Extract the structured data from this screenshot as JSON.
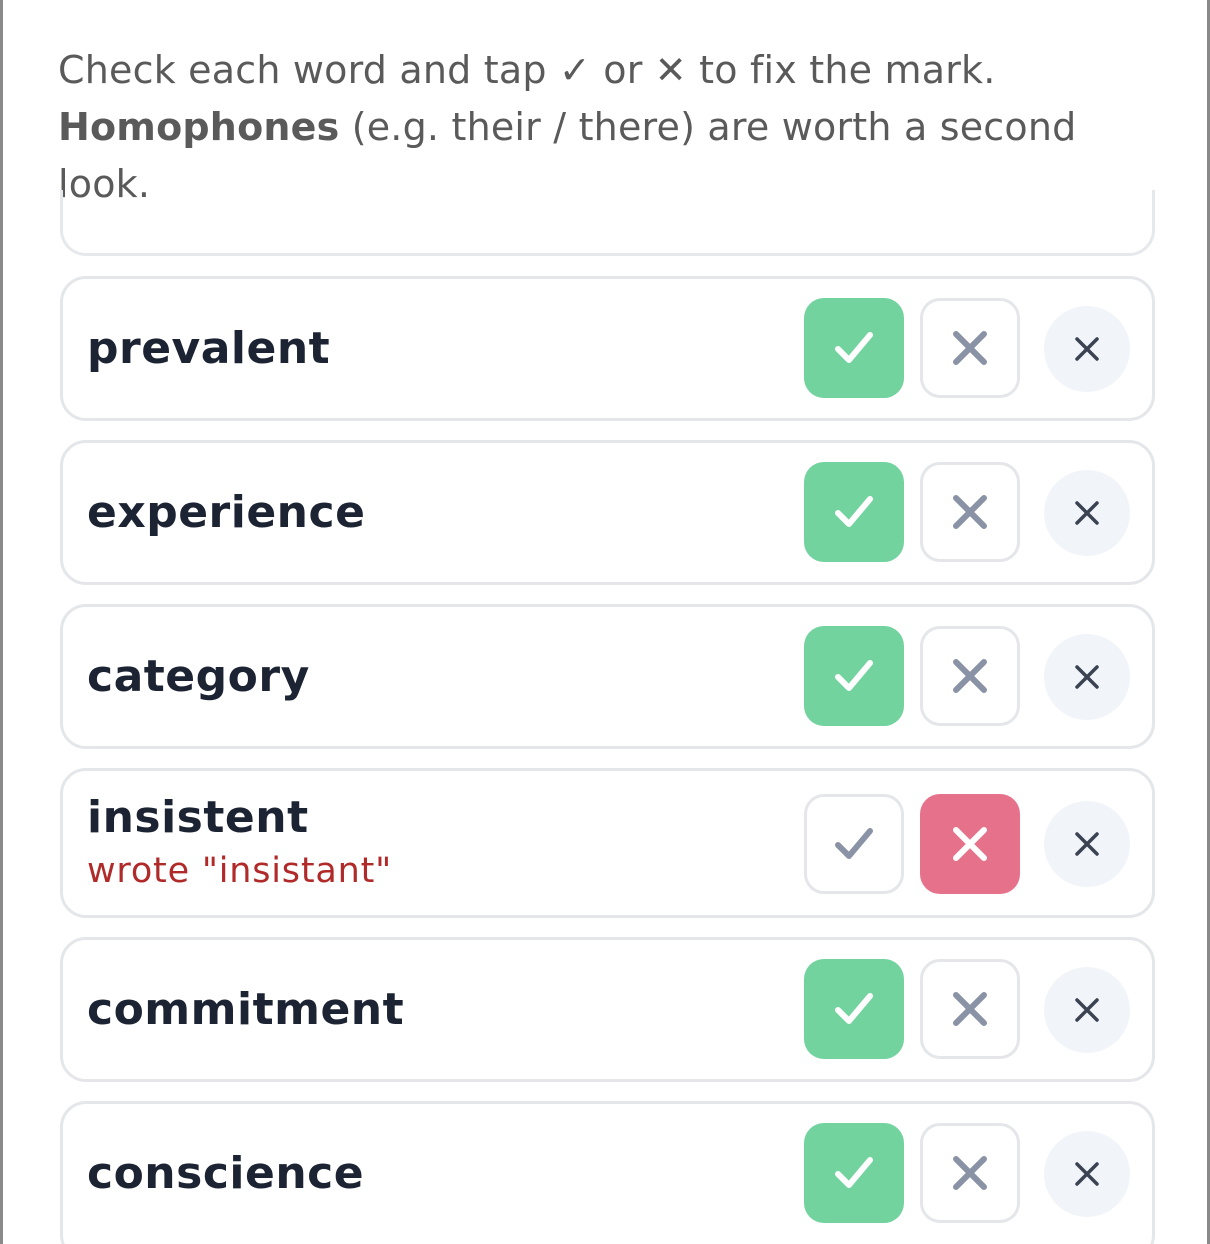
{
  "instructions": {
    "line1": "Check each word and tap ✓ or ✕ to fix the mark.",
    "bold": "Homophones",
    "rest": " (e.g. their / there) are worth a second look."
  },
  "words": [
    {
      "word": "prevalent",
      "wrote": "",
      "mark": "correct"
    },
    {
      "word": "experience",
      "wrote": "",
      "mark": "correct"
    },
    {
      "word": "category",
      "wrote": "",
      "mark": "correct"
    },
    {
      "word": "insistent",
      "wrote": "wrote \"insistant\"",
      "mark": "incorrect"
    },
    {
      "word": "commitment",
      "wrote": "",
      "mark": "correct"
    },
    {
      "word": "conscience",
      "wrote": "",
      "mark": "correct"
    }
  ],
  "icons": {
    "mark_correct": "check-icon",
    "mark_incorrect": "x-icon",
    "remove": "close-icon"
  },
  "colors": {
    "correct_active": "#72d39f",
    "incorrect_active": "#e6718b",
    "inactive_icon": "#8a93a6",
    "wrote_text": "#b02a2a",
    "word_text": "#1c2333"
  }
}
